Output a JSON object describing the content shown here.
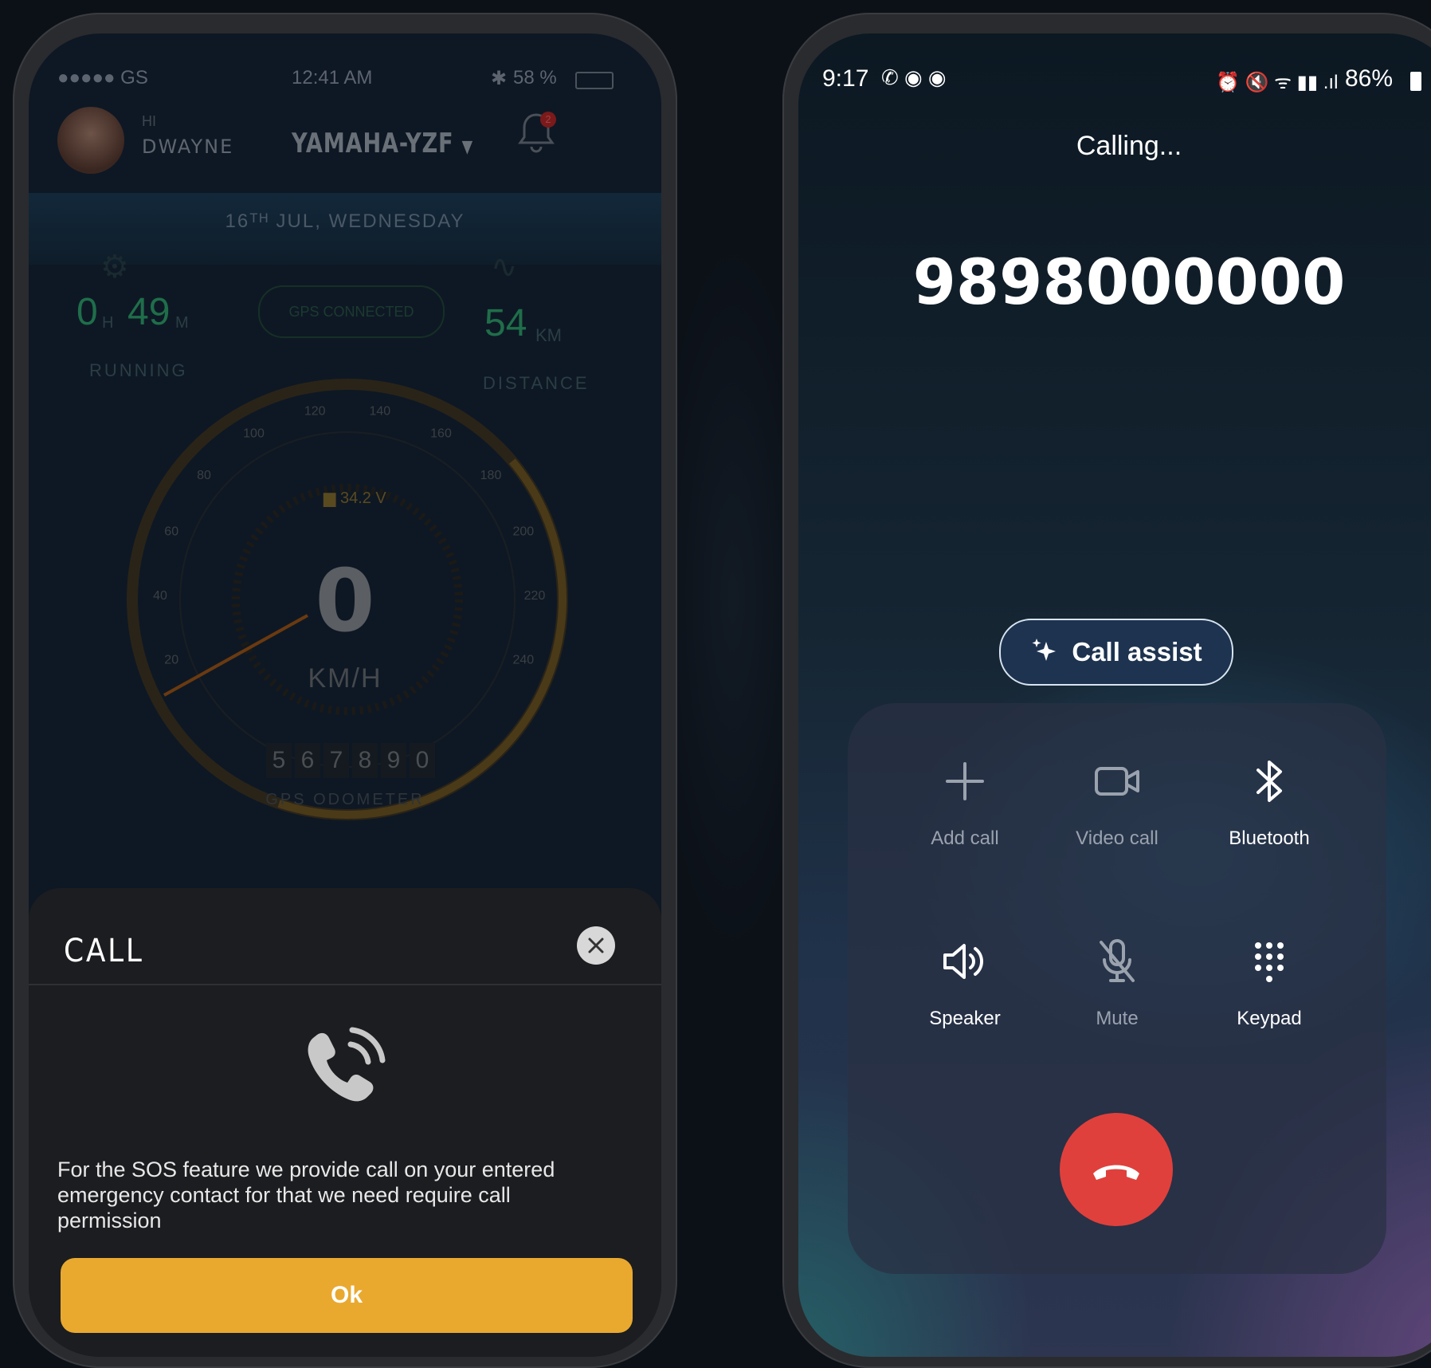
{
  "left": {
    "status_bar": {
      "carrier": "●●●●● GS",
      "time": "12:41 AM",
      "battery": "58 %"
    },
    "header": {
      "greeting": "HI",
      "user_name": "DWAYNE",
      "bike": "YAMAHA-YZF",
      "notifications": "2"
    },
    "date": "16ᵀᴴ JUL, WEDNESDAY",
    "running": {
      "hours": "0",
      "h_unit": "H",
      "minutes": "49",
      "m_unit": "M",
      "label": "RUNNING"
    },
    "gps_status": "GPS CONNECTED",
    "distance": {
      "value": "54",
      "unit": "KM",
      "label": "DISTANCE"
    },
    "battery_voltage": "34.2 V",
    "gauge_ticks": [
      "20",
      "40",
      "60",
      "80",
      "100",
      "120",
      "140",
      "160",
      "180",
      "200",
      "220",
      "240"
    ],
    "speed": "0",
    "speed_unit": "KM/H",
    "odometer_digits": [
      "5",
      "6",
      "7",
      "8",
      "9",
      "0"
    ],
    "odometer_label": "GPS ODOMETER",
    "dialog": {
      "title": "CALL",
      "message": "For the SOS feature we provide call on your entered emergency contact for that we need require call permission",
      "ok_label": "Ok"
    }
  },
  "right": {
    "status_bar": {
      "time": "9:17",
      "battery": "86%"
    },
    "call_status": "Calling...",
    "phone_number": "9898000000",
    "call_assist_label": "Call assist",
    "controls": [
      {
        "label": "Add call",
        "icon": "plus-icon",
        "enabled": false
      },
      {
        "label": "Video call",
        "icon": "video-icon",
        "enabled": false
      },
      {
        "label": "Bluetooth",
        "icon": "bluetooth-icon",
        "enabled": true
      },
      {
        "label": "Speaker",
        "icon": "speaker-icon",
        "enabled": true
      },
      {
        "label": "Mute",
        "icon": "mic-off-icon",
        "enabled": false
      },
      {
        "label": "Keypad",
        "icon": "keypad-icon",
        "enabled": true
      }
    ],
    "end_call_color": "#e0403c"
  },
  "colors": {
    "ok_button": "#e9a92f",
    "green_stat": "#1f6e4a",
    "assist_bg": "#1d3350"
  }
}
